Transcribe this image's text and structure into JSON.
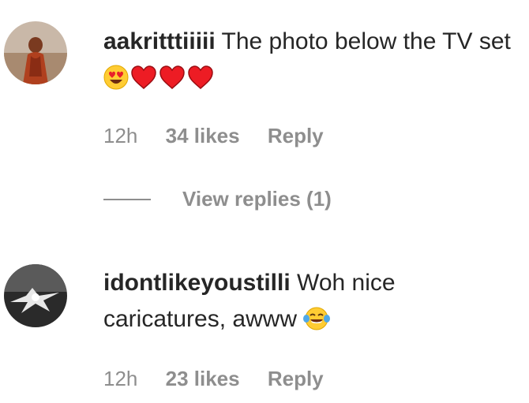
{
  "comments": [
    {
      "username": "aakritttiiiii",
      "text": "The photo below the TV set",
      "emojis": [
        "heart-eyes-emoji",
        "red-heart-emoji",
        "red-heart-emoji",
        "red-heart-emoji"
      ],
      "time": "12h",
      "likes": "34 likes",
      "reply": "Reply",
      "view_replies": "View replies (1)"
    },
    {
      "username": "idontlikeyoustilli",
      "text": "Woh nice caricatures, awww",
      "emojis": [
        "tears-of-joy-emoji"
      ],
      "time": "12h",
      "likes": "23 likes",
      "reply": "Reply"
    }
  ],
  "colors": {
    "text": "#262626",
    "meta": "#8e8e8e",
    "heart": "#ed1c24",
    "emoji_face": "#ffcc33"
  }
}
